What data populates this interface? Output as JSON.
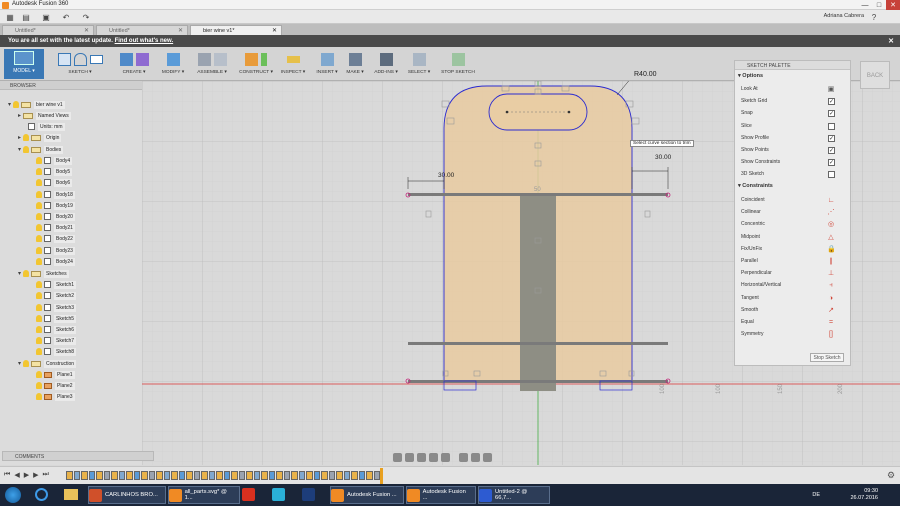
{
  "window": {
    "title": "Autodesk Fusion 360",
    "minimize": "—",
    "maximize": "□",
    "close": "✕"
  },
  "app_toolbar": {
    "user": "Adriana Cabrera",
    "undo": "↶",
    "redo": "↷",
    "save": "▣",
    "grid": "▦",
    "help": "?"
  },
  "tabs": [
    {
      "label": "Untitled*",
      "active": false
    },
    {
      "label": "Untitled*",
      "active": false
    },
    {
      "label": "bier wine v1*",
      "active": true
    }
  ],
  "notification": {
    "text": "You are all set with the latest update.",
    "link": "Find out what's new."
  },
  "ribbon": {
    "model": "MODEL ▾",
    "groups": [
      {
        "label": "SKETCH ▾"
      },
      {
        "label": "CREATE ▾"
      },
      {
        "label": "MODIFY ▾"
      },
      {
        "label": "ASSEMBLE ▾"
      },
      {
        "label": "CONSTRUCT ▾"
      },
      {
        "label": "INSPECT ▾"
      },
      {
        "label": "INSERT ▾"
      },
      {
        "label": "MAKE ▾"
      },
      {
        "label": "ADD-INS ▾"
      },
      {
        "label": "SELECT ▾"
      },
      {
        "label": "STOP SKETCH"
      }
    ]
  },
  "browser": {
    "header": "BROWSER",
    "root": "bier wine v1",
    "named_views": "Named Views",
    "units": "Units: mm",
    "origin": "Origin",
    "bodies": "Bodies",
    "body_items": [
      "Body4",
      "Body5",
      "Body6",
      "Body18",
      "Body19",
      "Body20",
      "Body21",
      "Body22",
      "Body23",
      "Body24"
    ],
    "sketches": "Sketches",
    "sketch_items": [
      "Sketch1",
      "Sketch2",
      "Sketch3",
      "Sketch5",
      "Sketch6",
      "Sketch7",
      "Sketch8"
    ],
    "construction": "Construction",
    "plane_items": [
      "Plane1",
      "Plane2",
      "Plane3"
    ]
  },
  "canvas": {
    "radius_label": "R40.00",
    "dim_left": "30.00",
    "dim_right": "30.00",
    "tooltip": "Select curve section to trim",
    "axis_ticks": [
      "250",
      "200",
      "150",
      "100",
      "50",
      "100",
      "150",
      "200",
      "250"
    ]
  },
  "palette": {
    "title": "SKETCH PALETTE",
    "options_title": "Options",
    "options": [
      {
        "label": "Look At",
        "kind": "icon"
      },
      {
        "label": "Sketch Grid",
        "checked": true
      },
      {
        "label": "Snap",
        "checked": true
      },
      {
        "label": "Slice",
        "checked": false
      },
      {
        "label": "Show Profile",
        "checked": true
      },
      {
        "label": "Show Points",
        "checked": true
      },
      {
        "label": "Show Constraints",
        "checked": true
      },
      {
        "label": "3D Sketch",
        "checked": false
      }
    ],
    "constraints_title": "Constraints",
    "constraints": [
      "Coincident",
      "Collinear",
      "Concentric",
      "Midpoint",
      "Fix/UnFix",
      "Parallel",
      "Perpendicular",
      "Horizontal/Vertical",
      "Tangent",
      "Smooth",
      "Equal",
      "Symmetry"
    ],
    "stop_button": "Stop Sketch",
    "back": "BACK"
  },
  "comments": "COMMENTS",
  "taskbar": {
    "items": [
      {
        "label": "CARLINHOS BRO...",
        "color": "#d0502a"
      },
      {
        "label": "all_parts.svg* @ 1...",
        "color": "#f08a24"
      },
      {
        "label": "Autodesk Fusion ...",
        "color": "#f08a24"
      },
      {
        "label": "Autodesk Fusion ...",
        "color": "#f08a24"
      },
      {
        "label": "Untitled-2 @ 66,7...",
        "color": "#2d5bd1"
      }
    ],
    "lang": "DE",
    "time": "09:30",
    "date": "26.07.2016"
  },
  "colors": {
    "accent": "#3a78b5",
    "body_fill": "#e8caa0",
    "sketch_blue": "#2b2bd0",
    "axis_red": "#d33",
    "axis_green": "#3a3"
  }
}
